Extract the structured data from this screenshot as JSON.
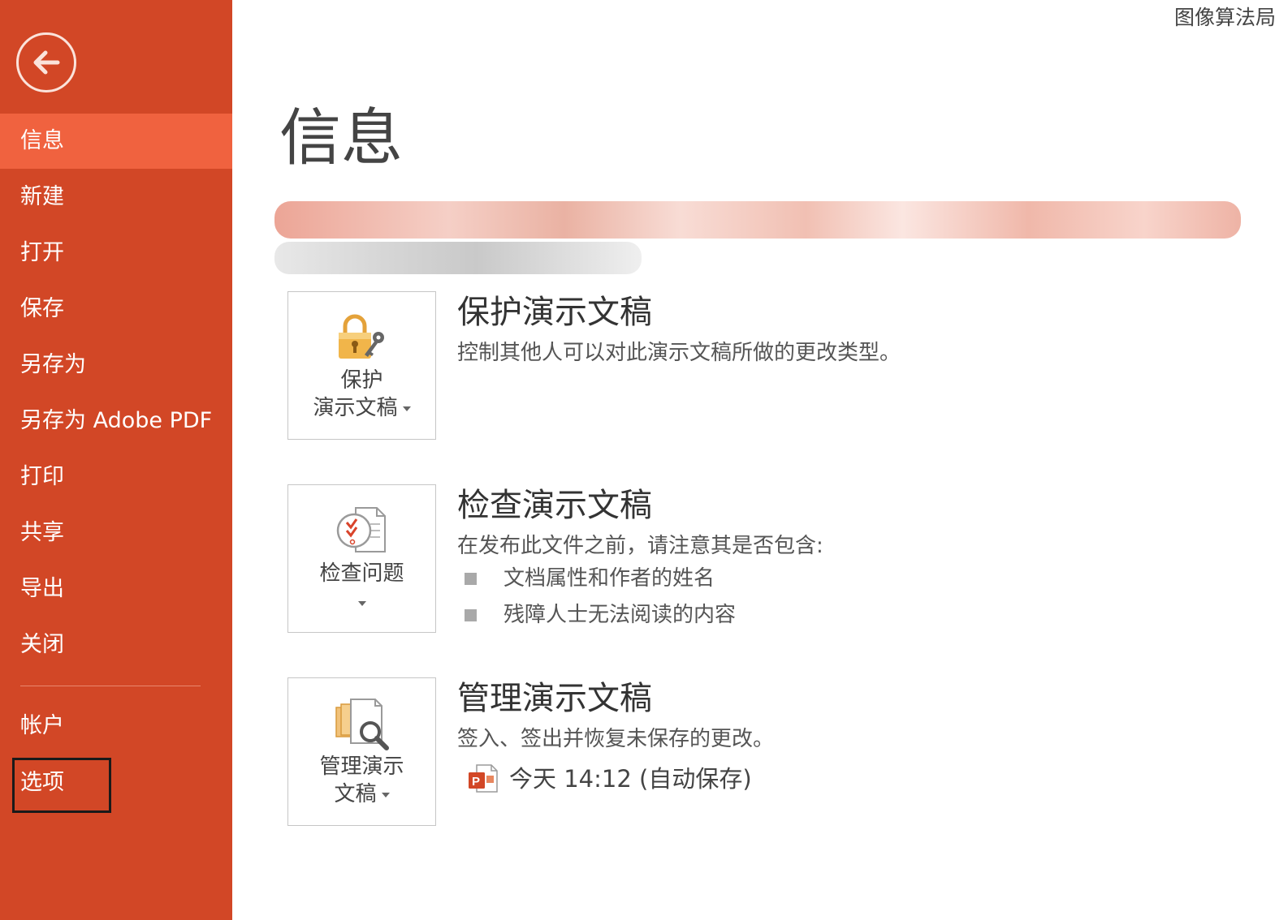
{
  "window": {
    "title_fragment": "图像算法局"
  },
  "sidebar": {
    "back_label": "back",
    "items": [
      {
        "label": "信息",
        "active": true
      },
      {
        "label": "新建"
      },
      {
        "label": "打开"
      },
      {
        "label": "保存"
      },
      {
        "label": "另存为"
      },
      {
        "label": "另存为 Adobe PDF"
      },
      {
        "label": "打印"
      },
      {
        "label": "共享"
      },
      {
        "label": "导出"
      },
      {
        "label": "关闭"
      },
      {
        "label": "帐户"
      },
      {
        "label": "选项"
      }
    ]
  },
  "main": {
    "title": "信息",
    "protect": {
      "button_line1": "保护",
      "button_line2": "演示文稿",
      "title": "保护演示文稿",
      "desc": "控制其他人可以对此演示文稿所做的更改类型。"
    },
    "inspect": {
      "button_label": "检查问题",
      "title": "检查演示文稿",
      "desc": "在发布此文件之前，请注意其是否包含:",
      "bullets": [
        "文档属性和作者的姓名",
        "残障人士无法阅读的内容"
      ]
    },
    "manage": {
      "button_line1": "管理演示",
      "button_line2": "文稿",
      "title": "管理演示文稿",
      "desc": "签入、签出并恢复未保存的更改。",
      "version": "今天 14:12 (自动保存)"
    }
  },
  "colors": {
    "sidebar": "#d24726",
    "sidebar_active": "#f0623f",
    "text": "#444444"
  }
}
